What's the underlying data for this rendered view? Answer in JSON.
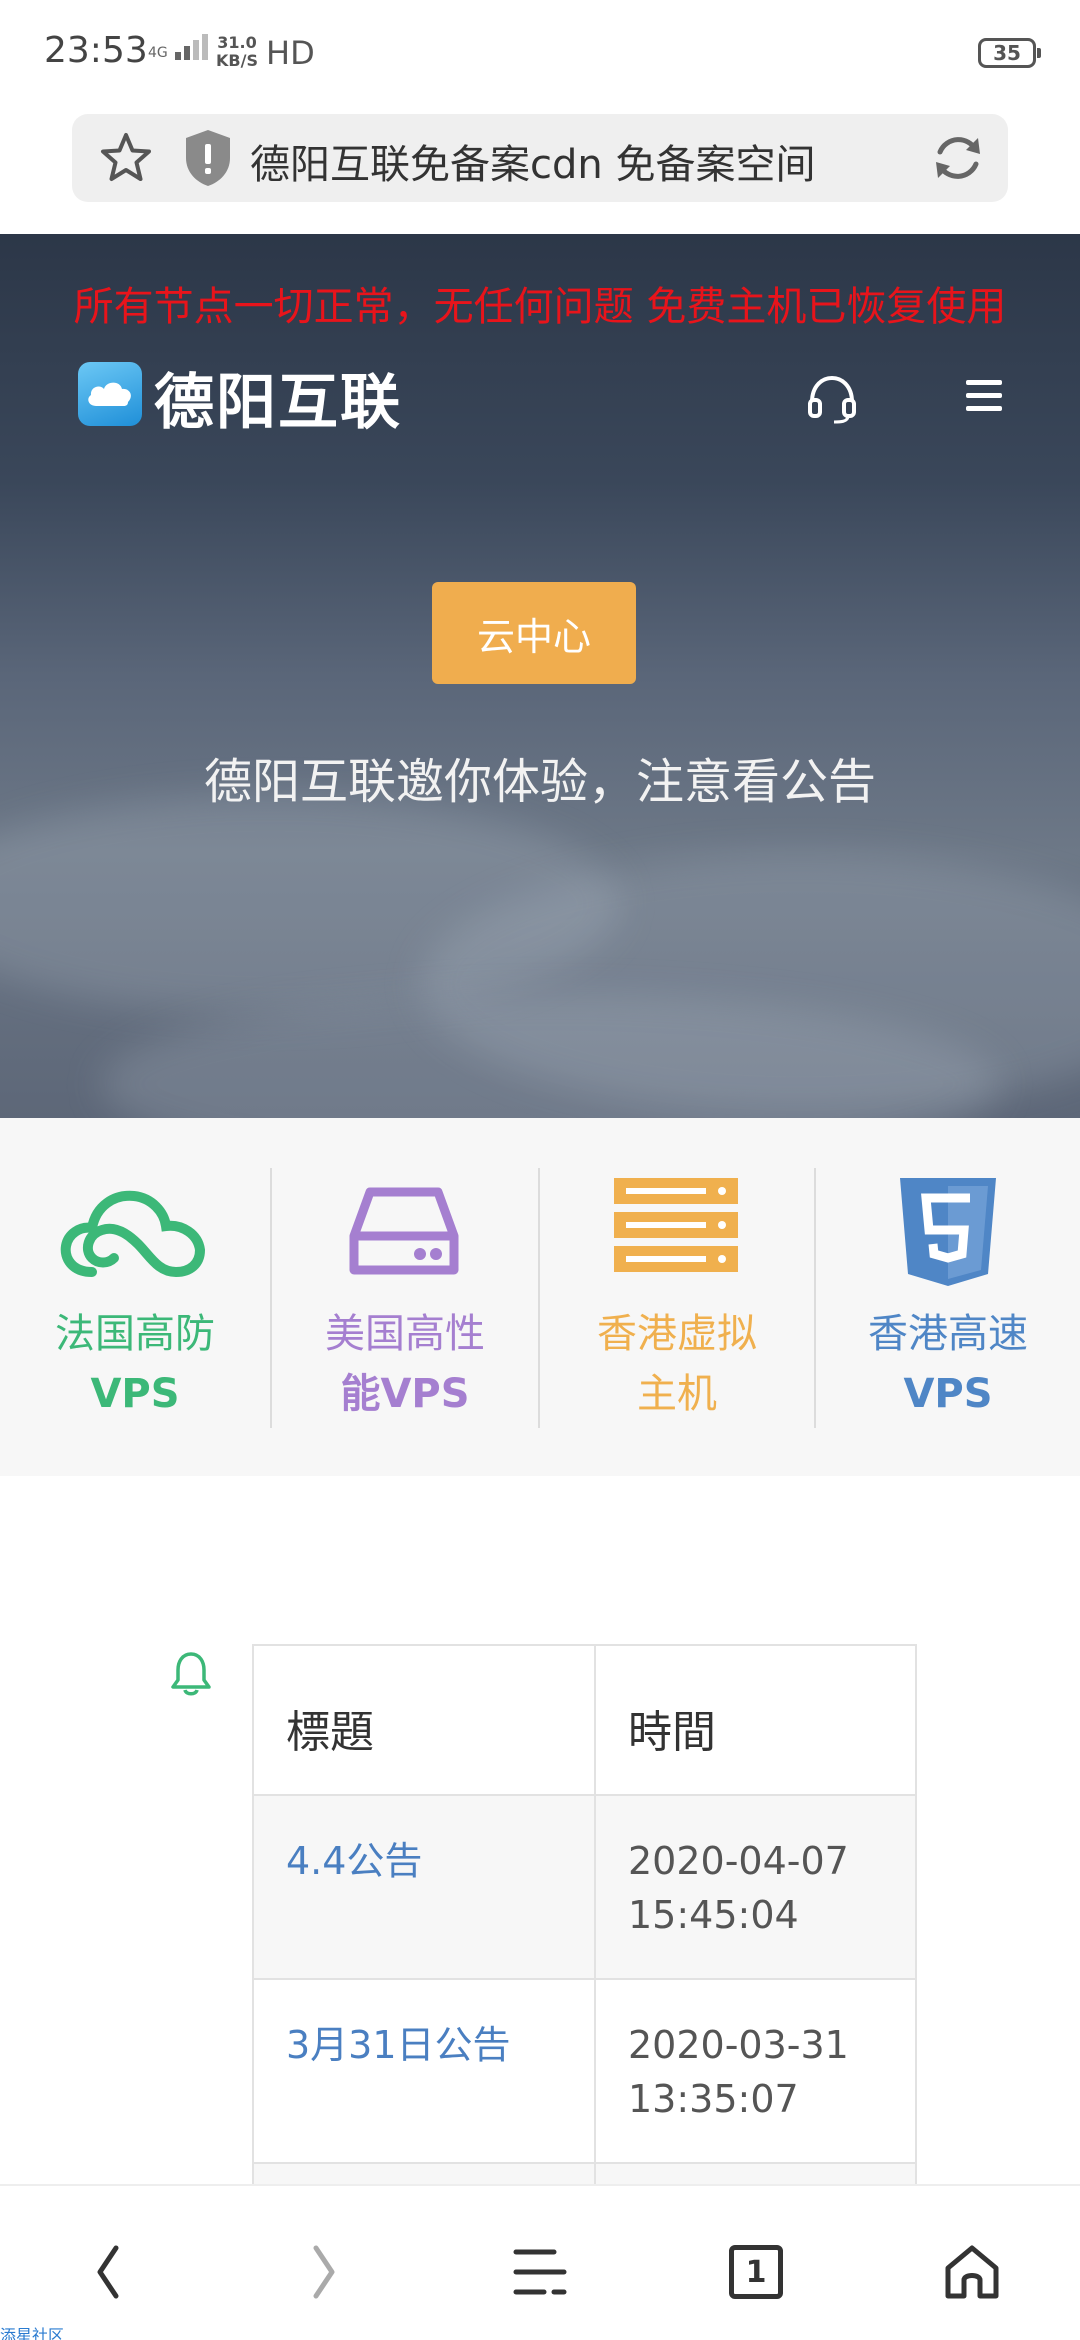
{
  "status_bar": {
    "time": "23:53",
    "network_type": "4G",
    "net_speed_value": "31.0",
    "net_speed_unit": "KB/S",
    "hd_label": "HD",
    "battery": "35"
  },
  "address_bar": {
    "url_title": "德阳互联免备案cdn 免备案空间"
  },
  "hero": {
    "notice": "所有节点一切正常，无任何问题 免费主机已恢复使用",
    "notice_color": "#e8141b",
    "logo_text": "德阳互联",
    "cloud_center_button": "云中心",
    "button_color": "#f0ad4e",
    "subtitle": "德阳互联邀你体验，注意看公告"
  },
  "services": [
    {
      "line1": "法国高防",
      "line2": "VPS",
      "icon": "cloud-icon",
      "color": "#3cb878"
    },
    {
      "line1": "美国高性",
      "line2": "能VPS",
      "icon": "server-drive-icon",
      "color": "#a57fd0"
    },
    {
      "line1": "香港虚拟",
      "line2": "主机",
      "icon": "server-rack-icon",
      "color": "#f0b04e"
    },
    {
      "line1": "香港高速",
      "line2": "VPS",
      "icon": "html5-icon",
      "color": "#4f86c6"
    }
  ],
  "notice_table": {
    "header_title": "標題",
    "header_time": "時間",
    "rows": [
      {
        "title": "4.4公告",
        "date": "2020-04-07",
        "time": "15:45:04"
      },
      {
        "title": "3月31日公告",
        "date": "2020-03-31",
        "time": "13:35:07"
      }
    ]
  },
  "bottom_nav": {
    "tab_count": "1"
  },
  "watermark": "添星社区"
}
